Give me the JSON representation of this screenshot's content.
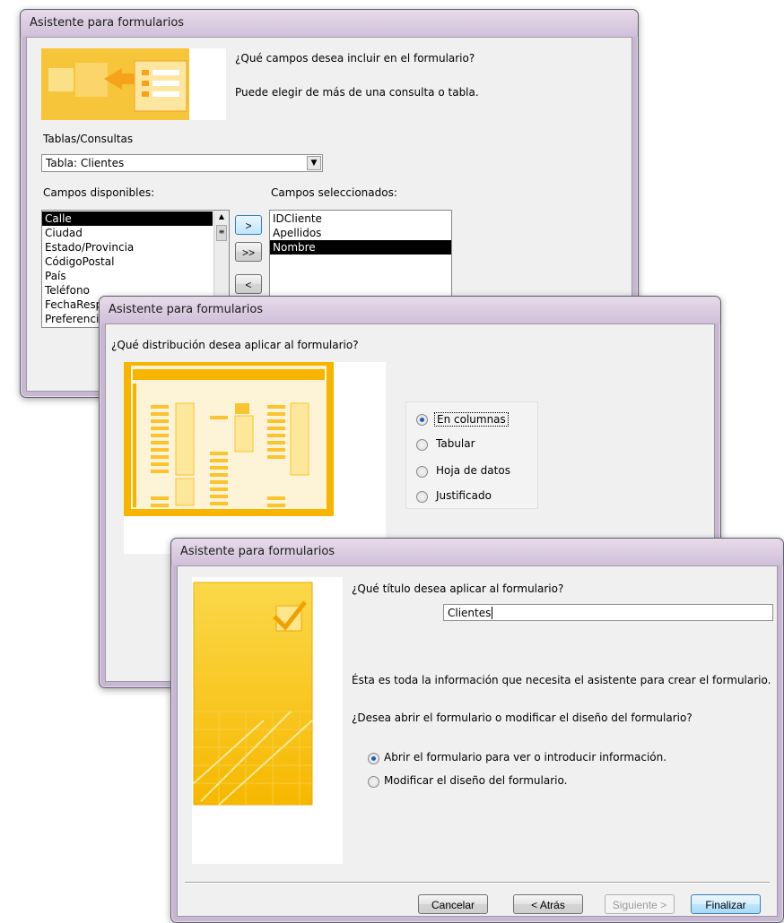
{
  "w1": {
    "title": "Asistente para formularios",
    "question": "¿Qué campos desea incluir en el formulario?",
    "hint": "Puede elegir de más de una consulta o tabla.",
    "tables_label": "Tablas/Consultas",
    "table_value": "Tabla: Clientes",
    "available_label": "Campos disponibles:",
    "selected_label": "Campos seleccionados:",
    "available": [
      "Calle",
      "Ciudad",
      "Estado/Provincia",
      "CódigoPostal",
      "País",
      "Teléfono",
      "FechaRespu",
      "Preferencia"
    ],
    "selected": [
      "IDCliente",
      "Apellidos",
      "Nombre"
    ],
    "btn_add": ">",
    "btn_add_all": ">>",
    "btn_remove": "<",
    "colors": {
      "selection": "#000000"
    }
  },
  "w2": {
    "title": "Asistente para formularios",
    "question": "¿Qué distribución desea aplicar al formulario?",
    "options": [
      "En columnas",
      "Tabular",
      "Hoja de datos",
      "Justificado"
    ],
    "selected_option": "En columnas"
  },
  "w3": {
    "title": "Asistente para formularios",
    "question": "¿Qué título desea aplicar al formulario?",
    "form_title": "Clientes",
    "info": "Ésta es toda la información que necesita el asistente para crear el formulario.",
    "ask": "¿Desea abrir el formulario o modificar el diseño del formulario?",
    "options": [
      "Abrir el formulario para ver o introducir información.",
      "Modificar el diseño del formulario."
    ],
    "selected_option": "Abrir el formulario para ver o introducir información.",
    "buttons": {
      "cancel": "Cancelar",
      "back": "< Atrás",
      "next": "Siguiente >",
      "finish": "Finalizar"
    }
  },
  "icons": [
    "form-wizard-illustration",
    "layout-columnar-illustration",
    "finish-checkmark-illustration",
    "dropdown-arrow-icon"
  ]
}
